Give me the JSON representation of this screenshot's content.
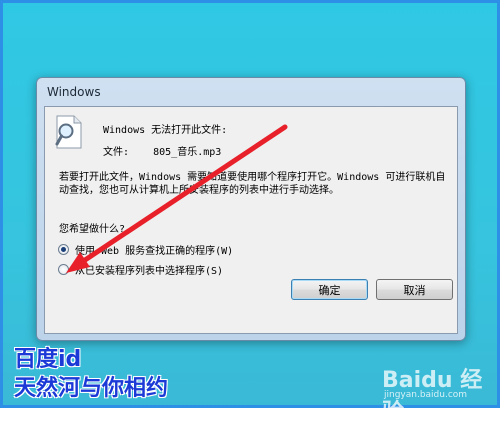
{
  "window": {
    "title": "Windows"
  },
  "dialog": {
    "message_line1": "Windows 无法打开此文件:",
    "file_label": "文件:",
    "file_name": "805_音乐.mp3",
    "description": "若要打开此文件，Windows 需要知道要使用哪个程序打开它。Windows 可进行联机自动查找，您也可从计算机上所安装程序的列表中进行手动选择。",
    "question": "您希望做什么?",
    "options": [
      {
        "label": "使用 Web 服务查找正确的程序(W)",
        "selected": true
      },
      {
        "label": "从已安装程序列表中选择程序(S)",
        "selected": false
      }
    ],
    "buttons": {
      "ok": "确定",
      "cancel": "取消"
    }
  },
  "overlay": {
    "line1": "百度id",
    "line2": "天然河与你相约",
    "arrow_color": "#e8202a"
  },
  "watermark": {
    "brand": "Baidu 经验",
    "url": "jingyan.baidu.com"
  }
}
